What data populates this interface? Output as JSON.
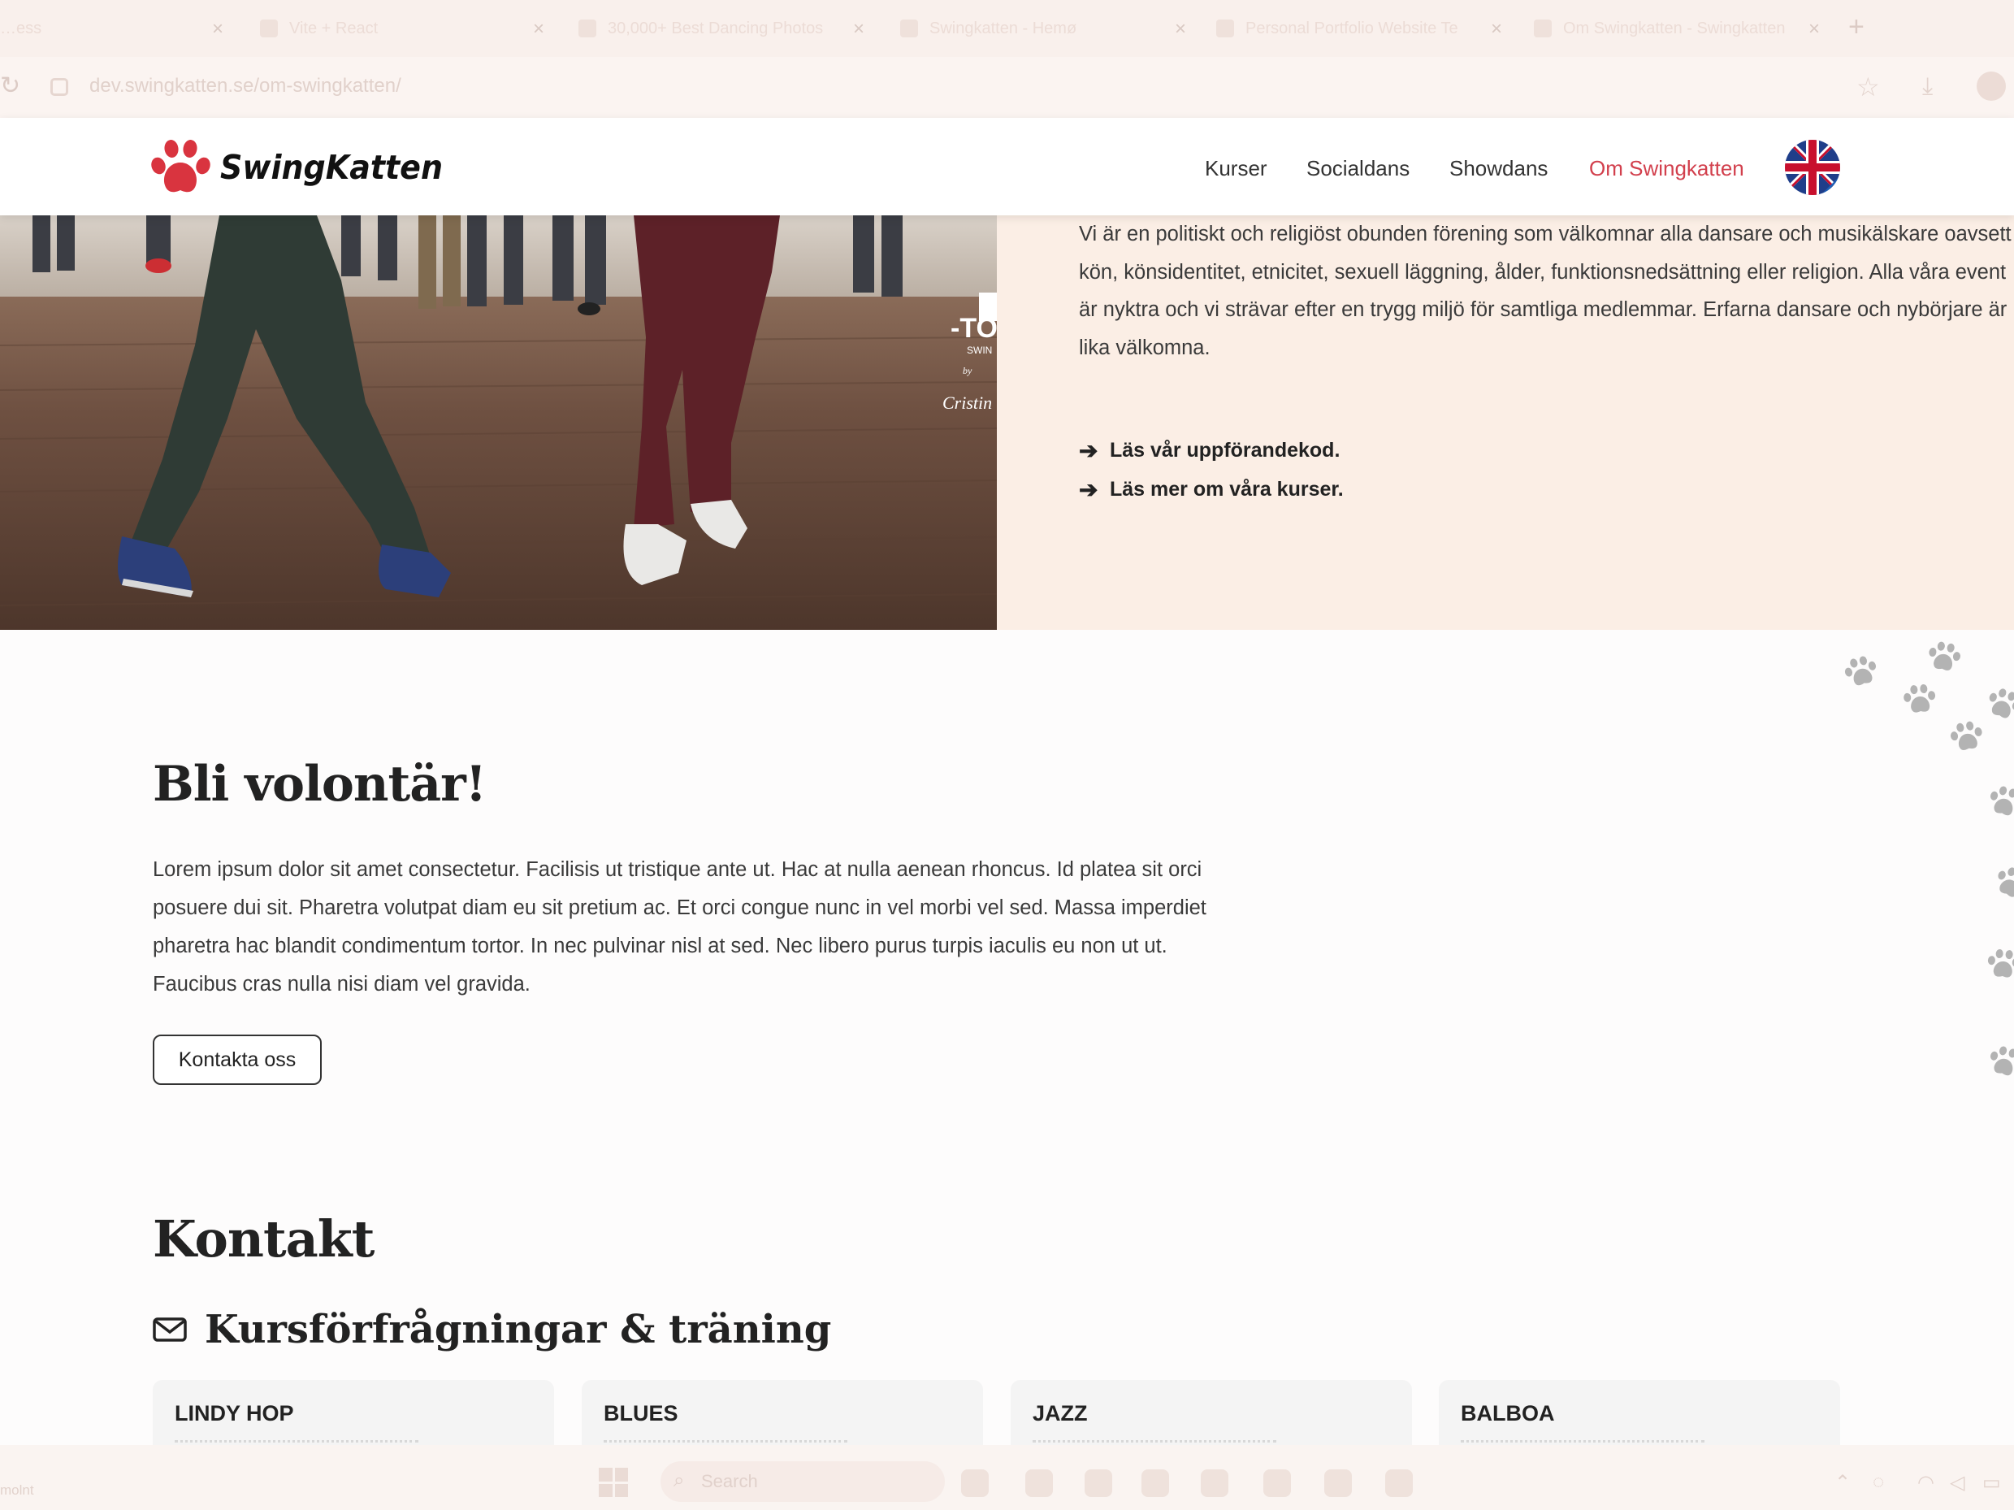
{
  "browser": {
    "tabs": [
      {
        "label": "…ess"
      },
      {
        "label": "Vite + React"
      },
      {
        "label": "30,000+ Best Dancing Photos"
      },
      {
        "label": "Swingkatten - Hemø"
      },
      {
        "label": "Personal Portfolio Website Te"
      },
      {
        "label": "Om Swingkatten - Swingkatten"
      }
    ],
    "url": "dev.swingkatten.se/om-swingkatten/"
  },
  "site": {
    "logo_text": "SwingKatten",
    "nav": [
      {
        "label": "Kurser"
      },
      {
        "label": "Socialdans"
      },
      {
        "label": "Showdans"
      },
      {
        "label": "Om Swingkatten"
      }
    ],
    "brand_color": "#d2404d"
  },
  "intro": {
    "text": "Vi är en politiskt och religiöst obunden förening som välkomnar alla dansare och musikälskare oavsett kön, könsidentitet, etnicitet, sexuell läggning, ålder, funktionsnedsättning eller religion. Alla våra event är nyktra och vi strävar efter en trygg miljö för samtliga medlemmar. Erfarna dansare och nybörjare är lika välkomna.",
    "links": [
      {
        "label": "Läs vår uppförandekod."
      },
      {
        "label": "Läs mer om våra kurser."
      }
    ]
  },
  "volunteer": {
    "title": "Bli volontär!",
    "text": "Lorem ipsum dolor sit amet consectetur. Facilisis ut tristique ante ut. Hac at nulla aenean rhoncus. Id platea sit orci posuere dui sit. Pharetra volutpat diam eu sit pretium ac. Et orci congue nunc in vel morbi vel sed. Massa imperdiet pharetra hac blandit condimentum tortor. In nec pulvinar nisl at sed. Nec libero purus turpis iaculis eu non ut ut. Faucibus cras nulla nisi diam vel gravida.",
    "button": "Kontakta oss"
  },
  "contact": {
    "title": "Kontakt",
    "subtitle": "Kursförfrågningar & träning",
    "cards": [
      {
        "title": "LINDY HOP"
      },
      {
        "title": "BLUES"
      },
      {
        "title": "JAZZ"
      },
      {
        "title": "BALBOA"
      }
    ]
  },
  "taskbar": {
    "search_placeholder": "Search",
    "left_label": "molnt"
  }
}
